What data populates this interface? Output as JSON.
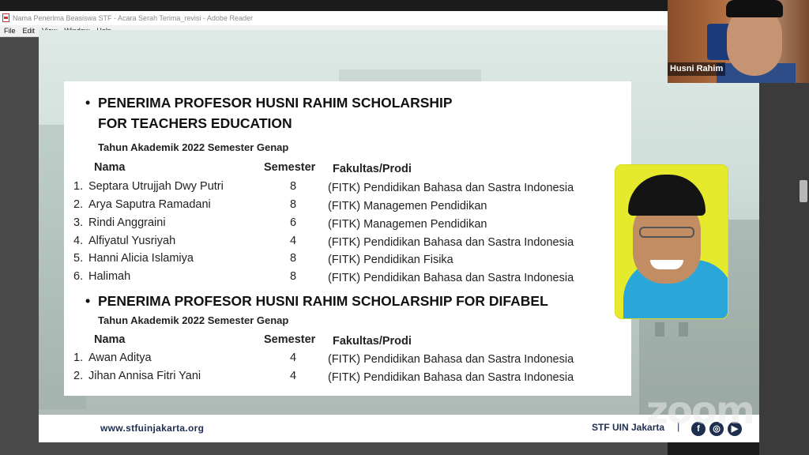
{
  "window": {
    "title": "Nama Penerima Beasiswa STF - Acara Serah Terima_revisi - Adobe Reader"
  },
  "menu": [
    "File",
    "Edit",
    "View",
    "Window",
    "Help"
  ],
  "slide": {
    "sections": [
      {
        "bullet": "•",
        "heading_line1": "PENERIMA PROFESOR HUSNI RAHIM SCHOLARSHIP",
        "heading_line2": "FOR TEACHERS EDUCATION",
        "subheading": "Tahun Akademik 2022 Semester Genap",
        "columns": {
          "name": "Nama",
          "semester": "Semester",
          "faculty": "Fakultas/Prodi"
        },
        "rows": [
          {
            "num": "1.",
            "name": "Septara Utrujjah Dwy Putri",
            "semester": "8",
            "faculty": "(FITK) Pendidikan Bahasa dan Sastra Indonesia"
          },
          {
            "num": "2.",
            "name": "Arya Saputra Ramadani",
            "semester": "8",
            "faculty": "(FITK) Managemen Pendidikan"
          },
          {
            "num": "3.",
            "name": "Rindi Anggraini",
            "semester": "6",
            "faculty": "(FITK) Managemen Pendidikan"
          },
          {
            "num": "4.",
            "name": "Alfiyatul Yusriyah",
            "semester": "4",
            "faculty": "(FITK) Pendidikan Bahasa dan Sastra Indonesia"
          },
          {
            "num": "5.",
            "name": "Hanni Alicia Islamiya",
            "semester": "8",
            "faculty": "(FITK) Pendidikan Fisika"
          },
          {
            "num": "6.",
            "name": "Halimah",
            "semester": "8",
            "faculty": "(FITK) Pendidikan Bahasa dan Sastra Indonesia"
          }
        ]
      },
      {
        "bullet": "•",
        "heading_line1": "PENERIMA PROFESOR HUSNI RAHIM SCHOLARSHIP FOR DIFABEL",
        "subheading": "Tahun Akademik 2022 Semester Genap",
        "columns": {
          "name": "Nama",
          "semester": "Semester",
          "faculty": "Fakultas/Prodi"
        },
        "rows": [
          {
            "num": "1.",
            "name": "Awan Aditya",
            "semester": "4",
            "faculty": "(FITK) Pendidikan Bahasa dan Sastra Indonesia"
          },
          {
            "num": "2.",
            "name": "Jihan Annisa Fitri Yani",
            "semester": "4",
            "faculty": "(FITK) Pendidikan Bahasa dan Sastra Indonesia"
          }
        ]
      }
    ],
    "footer": {
      "url": "www.stfuinjakarta.org",
      "brand": "STF UIN Jakarta",
      "separator": "|",
      "social": [
        "facebook-icon",
        "instagram-icon",
        "youtube-icon"
      ]
    }
  },
  "video": {
    "participant_name": "Husni Rahim",
    "watermark": "zoom"
  },
  "colors": {
    "brand_navy": "#1d2e4f",
    "photo_background": "#e6ea2c",
    "shirt_blue": "#2aa7d8"
  }
}
